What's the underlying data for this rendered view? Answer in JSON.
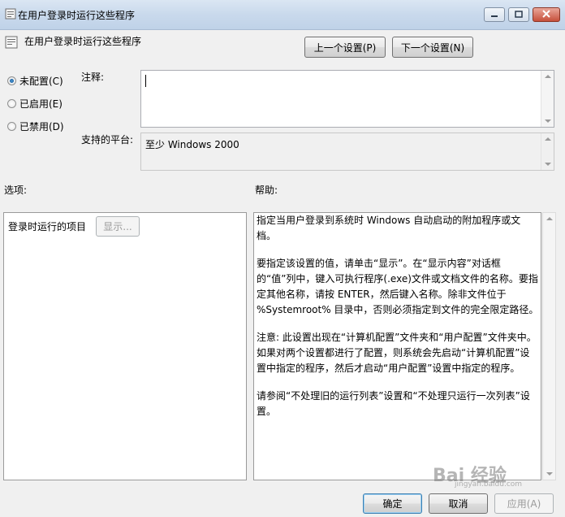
{
  "window": {
    "title": "在用户登录时运行这些程序",
    "minimize_icon": "minimize-icon",
    "maximize_icon": "maximize-icon",
    "close_icon": "close-icon"
  },
  "header": {
    "setting_name": "在用户登录时运行这些程序",
    "prev_button": "上一个设置(P)",
    "next_button": "下一个设置(N)"
  },
  "state": {
    "options": [
      {
        "label": "未配置(C)",
        "checked": true
      },
      {
        "label": "已启用(E)",
        "checked": false
      },
      {
        "label": "已禁用(D)",
        "checked": false
      }
    ]
  },
  "comment": {
    "label": "注释:",
    "value": ""
  },
  "platform": {
    "label": "支持的平台:",
    "value": "至少 Windows 2000"
  },
  "options_panel": {
    "heading": "选项:",
    "item_label": "登录时运行的项目",
    "show_button": "显示..."
  },
  "help_panel": {
    "heading": "帮助:",
    "paragraphs": [
      "指定当用户登录到系统时 Windows 自动启动的附加程序或文档。",
      "要指定该设置的值，请单击“显示”。在“显示内容”对话框的“值”列中，键入可执行程序(.exe)文件或文档文件的名称。要指定其他名称，请按 ENTER，然后键入名称。除非文件位于 %Systemroot% 目录中，否则必须指定到文件的完全限定路径。",
      "注意: 此设置出现在“计算机配置”文件夹和“用户配置”文件夹中。如果对两个设置都进行了配置，则系统会先启动“计算机配置”设置中指定的程序，然后才启动“用户配置”设置中指定的程序。",
      "请参阅“不处理旧的运行列表”设置和“不处理只运行一次列表”设置。"
    ]
  },
  "footer": {
    "ok_button": "确定",
    "cancel_button": "取消",
    "apply_button": "应用(A)"
  },
  "watermark": {
    "text": "Bai 经验",
    "sub": "jingyan.baidu.com"
  }
}
